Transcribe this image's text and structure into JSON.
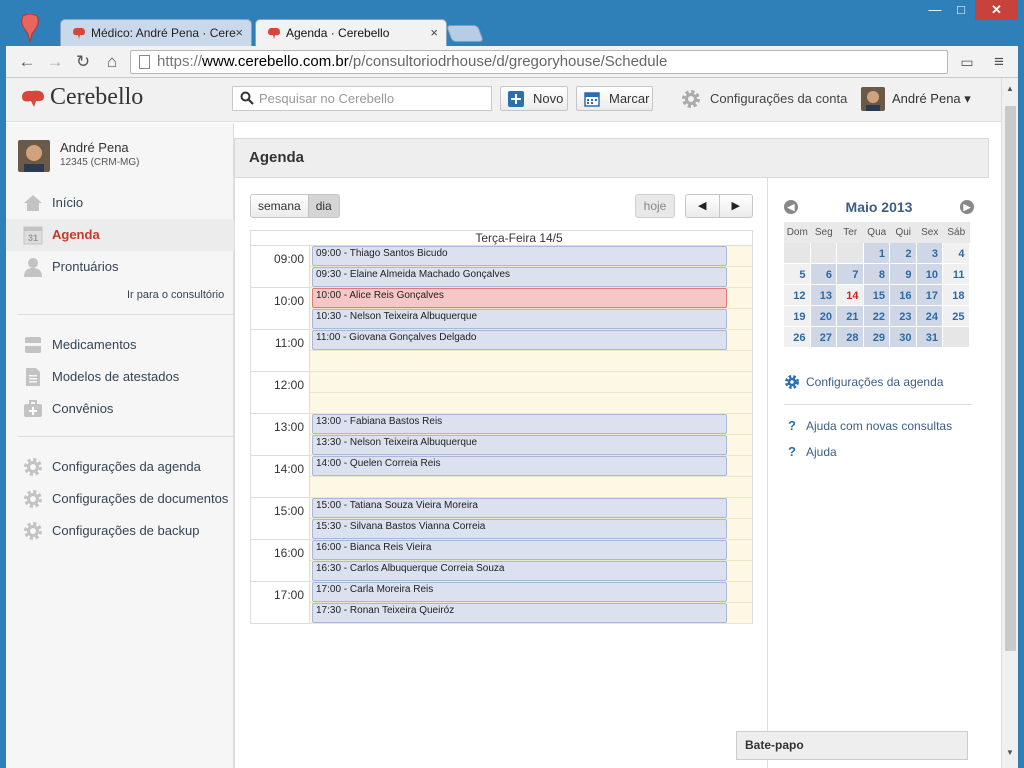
{
  "browser": {
    "tabs": [
      {
        "label": "Médico: André Pena · Cere",
        "close": "×"
      },
      {
        "label": "Agenda · Cerebello",
        "close": "×"
      }
    ],
    "window": {
      "minimize": "—",
      "maximize": "□",
      "close": "✕"
    },
    "url": {
      "scheme": "https://",
      "domain": "www.cerebello.com.br",
      "path": "/p/consultoriodrhouse/d/gregoryhouse/Schedule"
    }
  },
  "header": {
    "logo": "Cerebello",
    "search_placeholder": "Pesquisar no Cerebello",
    "novo_label": "Novo",
    "marcar_label": "Marcar",
    "config_label": "Configurações da conta",
    "user_label": "André Pena ▾"
  },
  "sidebar": {
    "doctor_name": "André Pena",
    "doctor_crm": "12345 (CRM-MG)",
    "items": [
      {
        "label": "Início",
        "icon": "home-icon"
      },
      {
        "label": "Agenda",
        "icon": "calendar-icon"
      },
      {
        "label": "Prontuários",
        "icon": "person-icon"
      }
    ],
    "consultorio_link": "Ir para o consultório",
    "items2": [
      {
        "label": "Medicamentos",
        "icon": "medicine-icon"
      },
      {
        "label": "Modelos de atestados",
        "icon": "document-icon"
      },
      {
        "label": "Convênios",
        "icon": "medical-kit-icon"
      }
    ],
    "items3": [
      {
        "label": "Configurações da agenda",
        "icon": "gear-icon"
      },
      {
        "label": "Configurações de documentos",
        "icon": "gear-icon"
      },
      {
        "label": "Configurações de backup",
        "icon": "gear-icon"
      }
    ]
  },
  "main": {
    "title": "Agenda",
    "view_week": "semana",
    "view_day": "dia",
    "today_label": "hoje",
    "prev_label": "◀",
    "next_label": "▶",
    "day_header": "Terça-Feira 14/5",
    "hours": [
      "09:00",
      "10:00",
      "11:00",
      "12:00",
      "13:00",
      "14:00",
      "15:00",
      "16:00",
      "17:00"
    ],
    "events": [
      {
        "slot": 0,
        "text": "09:00 - Thiago Santos Bicudo",
        "highlight": false
      },
      {
        "slot": 1,
        "text": "09:30 - Elaine Almeida Machado Gonçalves",
        "highlight": false
      },
      {
        "slot": 2,
        "text": "10:00 - Alice Reis Gonçalves",
        "highlight": true
      },
      {
        "slot": 3,
        "text": "10:30 - Nelson Teixeira Albuquerque",
        "highlight": false
      },
      {
        "slot": 4,
        "text": "11:00 - Giovana Gonçalves Delgado",
        "highlight": false
      },
      {
        "slot": 8,
        "text": "13:00 - Fabiana Bastos Reis",
        "highlight": false
      },
      {
        "slot": 9,
        "text": "13:30 - Nelson Teixeira Albuquerque",
        "highlight": false
      },
      {
        "slot": 10,
        "text": "14:00 - Quelen Correia Reis",
        "highlight": false
      },
      {
        "slot": 12,
        "text": "15:00 - Tatiana Souza Vieira Moreira",
        "highlight": false
      },
      {
        "slot": 13,
        "text": "15:30 - Silvana Bastos Vianna Correia",
        "highlight": false
      },
      {
        "slot": 14,
        "text": "16:00 - Bianca Reis Vieira",
        "highlight": false
      },
      {
        "slot": 15,
        "text": "16:30 - Carlos Albuquerque Correia Souza",
        "highlight": false
      },
      {
        "slot": 16,
        "text": "17:00 - Carla Moreira Reis",
        "highlight": false
      },
      {
        "slot": 17,
        "text": "17:30 - Ronan Teixeira Queiróz",
        "highlight": false
      }
    ]
  },
  "minical": {
    "month": "Maio 2013",
    "prev": "◀",
    "next": "▶",
    "weekdays": [
      "Dom",
      "Seg",
      "Ter",
      "Qua",
      "Qui",
      "Sex",
      "Sáb"
    ],
    "weeks": [
      [
        "",
        "",
        "",
        "1",
        "2",
        "3",
        "4"
      ],
      [
        "5",
        "6",
        "7",
        "8",
        "9",
        "10",
        "11"
      ],
      [
        "12",
        "13",
        "14",
        "15",
        "16",
        "17",
        "18"
      ],
      [
        "19",
        "20",
        "21",
        "22",
        "23",
        "24",
        "25"
      ],
      [
        "26",
        "27",
        "28",
        "29",
        "30",
        "31",
        ""
      ]
    ],
    "today": "14"
  },
  "rightlinks": {
    "config_agenda": "Configurações da agenda",
    "help_new": "Ajuda com novas consultas",
    "help": "Ajuda",
    "help_icon": "?"
  },
  "chat": {
    "label": "Bate-papo"
  },
  "colors": {
    "accent_red": "#c8382a",
    "link_blue": "#3b5f84",
    "event_blue": "#dbe1ef",
    "event_red": "#f7c6c6",
    "grid_bg": "#fdf8e4"
  }
}
